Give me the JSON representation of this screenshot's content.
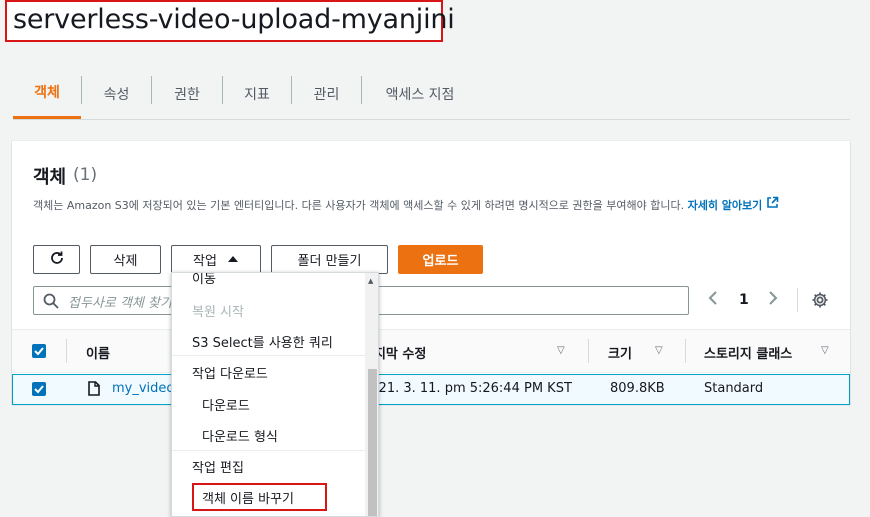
{
  "bucket": {
    "name": "serverless-video-upload-myanjini"
  },
  "tabs": [
    {
      "label": "객체",
      "active": true
    },
    {
      "label": "속성"
    },
    {
      "label": "권한"
    },
    {
      "label": "지표"
    },
    {
      "label": "관리"
    },
    {
      "label": "액세스 지점"
    }
  ],
  "objects_panel": {
    "title": "객체",
    "count": "(1)",
    "description_prefix": "객체는 Amazon S3에 저장되어 있는 기본 엔터티입니다. 다른 사용자가 객체에 액세스할 수 있게 하려면 명시적으로 권한을 부여해야 합니다. ",
    "learn_more": "자세히 알아보기"
  },
  "toolbar": {
    "refresh_icon": "refresh-icon",
    "delete_label": "삭제",
    "actions_label": "작업",
    "create_folder_label": "폴더 만들기",
    "upload_label": "업로드"
  },
  "search": {
    "placeholder": "접두사로 객체 찾기"
  },
  "pagination": {
    "page": "1"
  },
  "table": {
    "columns": {
      "name": "이름",
      "last_modified": "마지막 수정",
      "size": "크기",
      "storage_class": "스토리지 클래스"
    },
    "rows": [
      {
        "name": "my_video",
        "last_modified": "2021. 3. 11. pm 5:26:44 PM KST",
        "size": "809.8KB",
        "storage_class": "Standard",
        "selected": true
      }
    ]
  },
  "actions_menu": {
    "items": [
      {
        "label": "이동",
        "disabled": false
      },
      {
        "label": "복원 시작",
        "disabled": true
      },
      {
        "label": "S3 Select를 사용한 쿼리",
        "disabled": false
      },
      {
        "label": "작업 다운로드",
        "group": true
      },
      {
        "label": "다운로드",
        "disabled": false
      },
      {
        "label": "다운로드 형식",
        "disabled": false
      },
      {
        "label": "작업 편집",
        "group": true
      },
      {
        "label": "객체 이름 바꾸기",
        "disabled": false,
        "highlighted": true
      }
    ]
  },
  "colors": {
    "accent": "#ec7211",
    "link": "#0073bb",
    "highlight": "#d91515"
  }
}
